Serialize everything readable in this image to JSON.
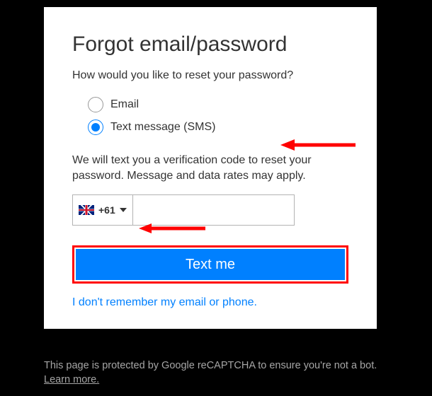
{
  "title": "Forgot email/password",
  "prompt": "How would you like to reset your password?",
  "options": {
    "email": "Email",
    "sms": "Text message (SMS)"
  },
  "helper": "We will text you a verification code to reset your password. Message and data rates may apply.",
  "country_code": "+61",
  "phone_value": "",
  "button": "Text me",
  "forgot_link": "I don't remember my email or phone.",
  "footer_text": "This page is protected by Google reCAPTCHA to ensure you're not a bot. ",
  "footer_link": "Learn more."
}
